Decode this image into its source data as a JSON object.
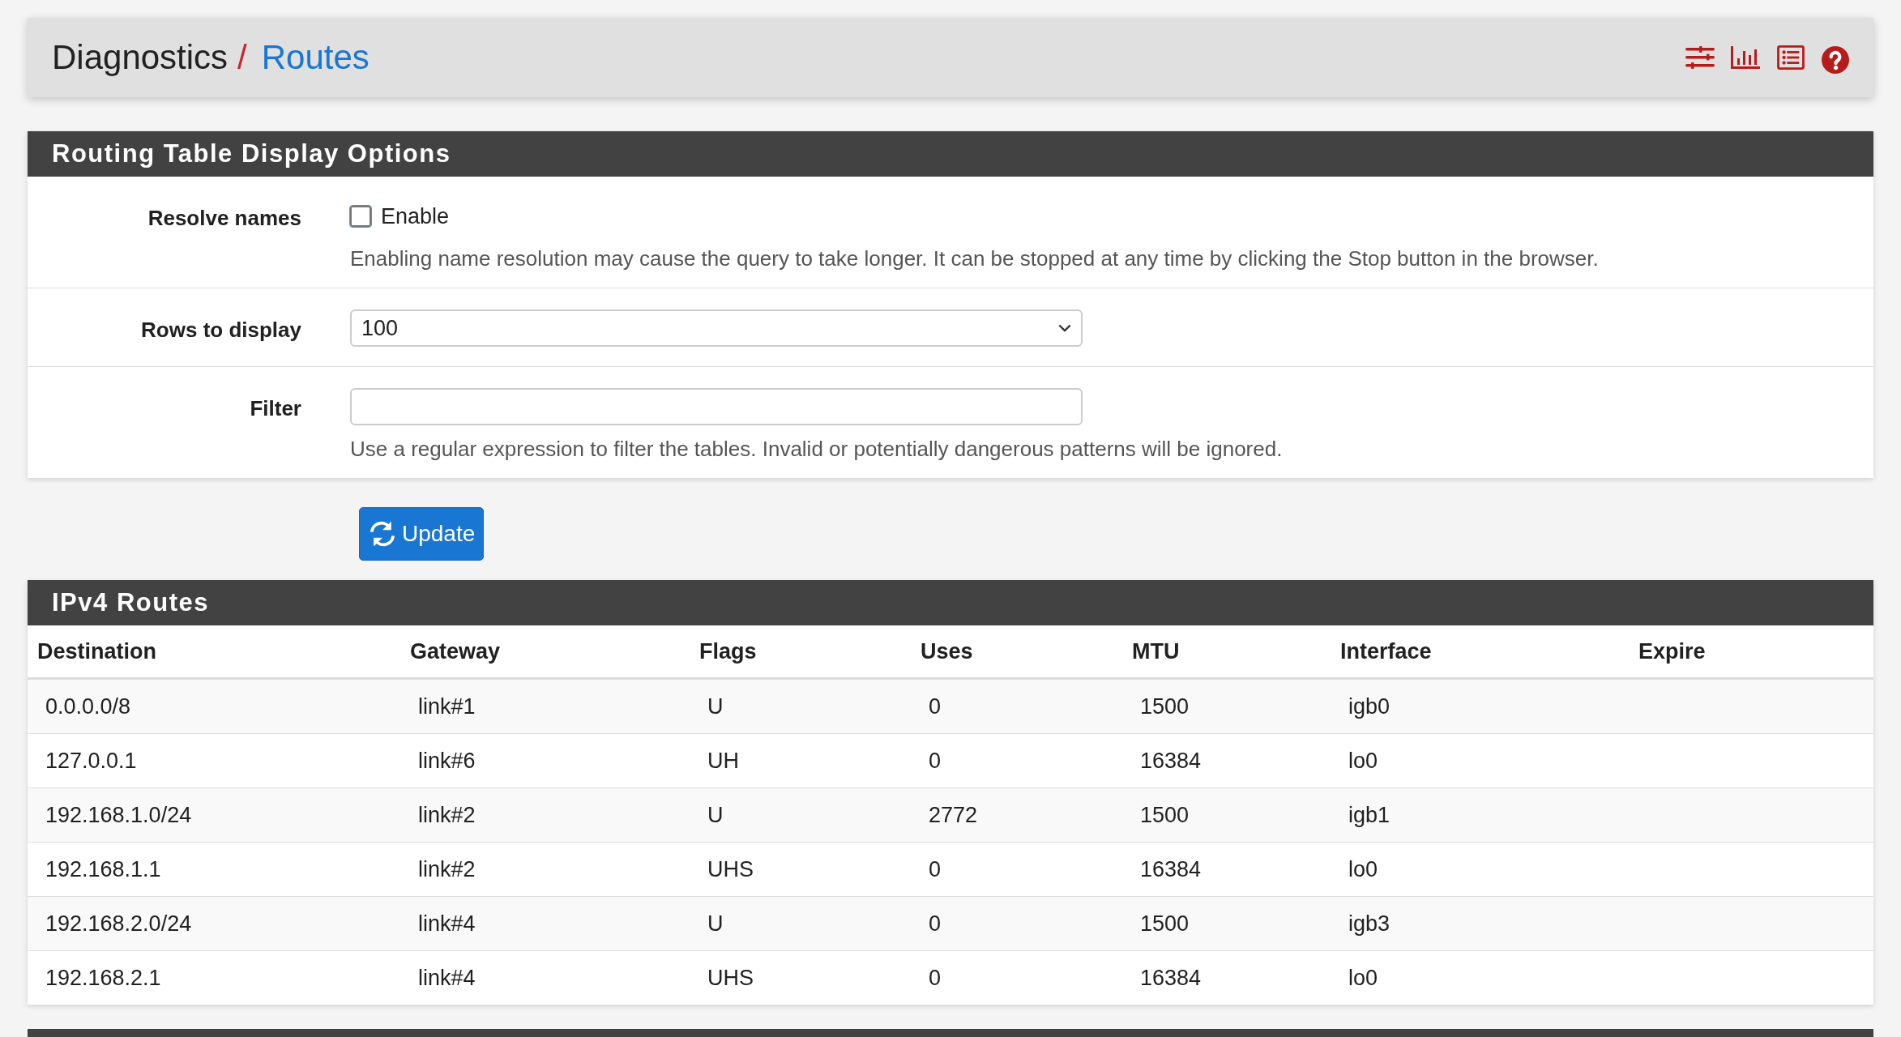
{
  "breadcrumb": {
    "section": "Diagnostics",
    "separator": "/",
    "page": "Routes"
  },
  "options_panel": {
    "title": "Routing Table Display Options",
    "rows": [
      {
        "kind": "checkbox",
        "label": "Resolve names",
        "option": "Enable",
        "checked": false,
        "help": "Enabling name resolution may cause the query to take longer. It can be stopped at any time by clicking the Stop button in the browser."
      },
      {
        "kind": "select",
        "label": "Rows to display",
        "value": "100"
      },
      {
        "kind": "text",
        "label": "Filter",
        "help": "Use a regular expression to filter the tables. Invalid or potentially dangerous patterns will be ignored."
      }
    ]
  },
  "update_button": "Update",
  "ipv4_routes": {
    "title": "IPv4 Routes",
    "columns": [
      "Destination",
      "Gateway",
      "Flags",
      "Uses",
      "MTU",
      "Interface",
      "Expire"
    ],
    "rows": [
      [
        "0.0.0.0/8",
        "link#1",
        "U",
        "0",
        "1500",
        "igb0",
        ""
      ],
      [
        "127.0.0.1",
        "link#6",
        "UH",
        "0",
        "16384",
        "lo0",
        ""
      ],
      [
        "192.168.1.0/24",
        "link#2",
        "U",
        "2772",
        "1500",
        "igb1",
        ""
      ],
      [
        "192.168.1.1",
        "link#2",
        "UHS",
        "0",
        "16384",
        "lo0",
        ""
      ],
      [
        "192.168.2.0/24",
        "link#4",
        "U",
        "0",
        "1500",
        "igb3",
        ""
      ],
      [
        "192.168.2.1",
        "link#4",
        "UHS",
        "0",
        "16384",
        "lo0",
        ""
      ]
    ]
  }
}
